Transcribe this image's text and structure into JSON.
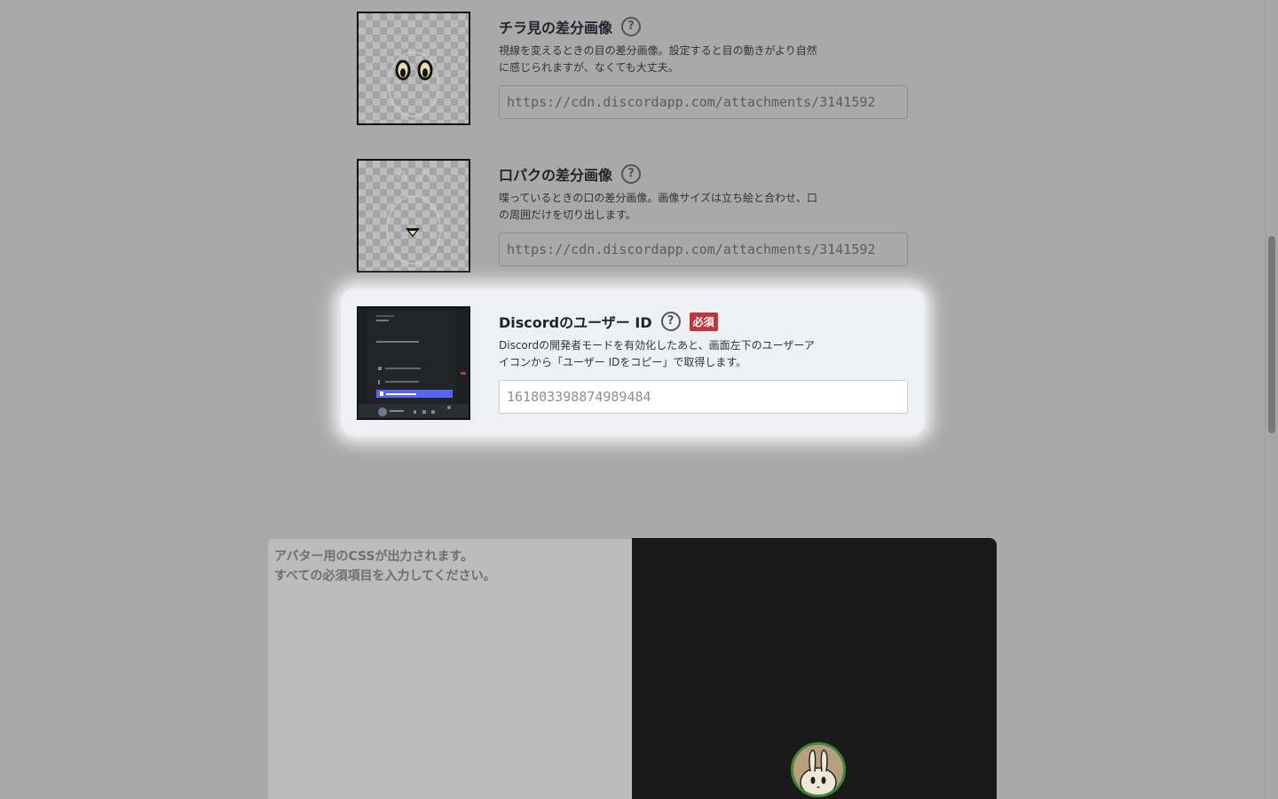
{
  "fields": [
    {
      "title": "チラ見の差分画像",
      "description_line1": "視線を変えるときの目の差分画像。設定すると目の動きがより自然",
      "description_line2": "に感じられますが、なくても大丈夫。",
      "value": "https://cdn.discordapp.com/attachments/3141592"
    },
    {
      "title": "口パクの差分画像",
      "description_line1": "喋っているときの口の差分画像。画像サイズは立ち絵と合わせ、口",
      "description_line2": "の周囲だけを切り出します。",
      "value": "https://cdn.discordapp.com/attachments/3141592"
    },
    {
      "title": "Discordのユーザー ID",
      "required_badge": "必須",
      "description_line1": "Discordの開発者モードを有効化したあと、画面左下のユーザーア",
      "description_line2": "イコンから「ユーザー IDをコピー」で取得します。",
      "placeholder": "161803398874989484"
    }
  ],
  "help_icon": "?",
  "output": {
    "line1": "アバター用のCSSが出力されます。",
    "line2": "すべての必須項目を入力してください。"
  },
  "colors": {
    "required": "#c0363f",
    "avatar_ring": "#3f8a3a",
    "preview_bg": "#1a1a1a"
  }
}
